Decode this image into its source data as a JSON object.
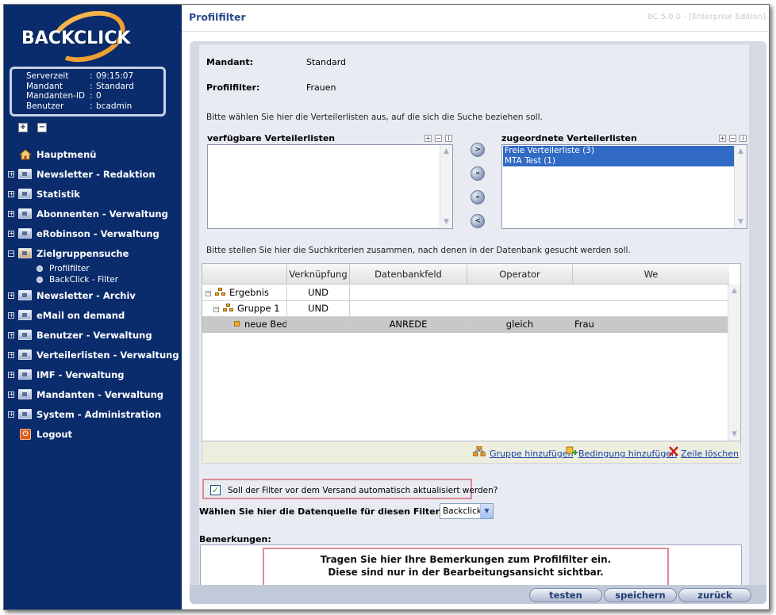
{
  "brand": {
    "logo_text": "BACKCLICK"
  },
  "server_info": {
    "rows": [
      {
        "key": "Serverzeit",
        "value": "09:15:07"
      },
      {
        "key": "Mandant",
        "value": "Standard"
      },
      {
        "key": "Mandanten-ID",
        "value": "0"
      },
      {
        "key": "Benutzer",
        "value": "bcadmin"
      }
    ]
  },
  "sidebar": {
    "items": [
      {
        "label": "Hauptmenü"
      },
      {
        "label": "Newsletter - Redaktion"
      },
      {
        "label": "Statistik"
      },
      {
        "label": "Abonnenten - Verwaltung"
      },
      {
        "label": "eRobinson - Verwaltung"
      },
      {
        "label": "Zielgruppensuche"
      },
      {
        "label": "Newsletter - Archiv"
      },
      {
        "label": "eMail on demand"
      },
      {
        "label": "Benutzer - Verwaltung"
      },
      {
        "label": "Verteilerlisten - Verwaltung"
      },
      {
        "label": "IMF - Verwaltung"
      },
      {
        "label": "Mandanten - Verwaltung"
      },
      {
        "label": "System - Administration"
      },
      {
        "label": "Logout"
      }
    ],
    "sub_items": [
      {
        "label": "Profilfilter"
      },
      {
        "label": "BackClick - Filter"
      }
    ]
  },
  "header": {
    "title": "Profilfilter",
    "version": "BC 5.0.0 - [Enterprise Edition]"
  },
  "form": {
    "mandant_label": "Mandant:",
    "mandant_value": "Standard",
    "filter_label": "Profilfilter:",
    "filter_value": "Frauen",
    "lists_hint": "Bitte wählen Sie hier die Verteilerlisten aus, auf die sich die Suche beziehen soll.",
    "available_title": "verfügbare Verteilerlisten",
    "assigned_title": "zugeordnete Verteilerlisten",
    "assigned_items": [
      "Freie Verteilerliste (3)",
      "MTA Test (1)"
    ],
    "criteria_hint": "Bitte stellen Sie hier die Suchkriterien zusammen, nach denen in der Datenbank gesucht werden soll.",
    "auto_update_label": "Soll der Filter vor dem Versand automatisch aktualisiert werden?",
    "auto_update_checked": true,
    "source_label": "Wählen Sie hier die Datenquelle für diesen Filter aus:",
    "source_value": "Backclick",
    "remarks_label": "Bemerkungen:",
    "remarks_note_line1": "Tragen Sie hier Ihre Bemerkungen zum Profilfilter ein.",
    "remarks_note_line2": "Diese sind nur in der Bearbeitungsansicht sichtbar."
  },
  "grid": {
    "columns": [
      "",
      "Verknüpfung",
      "Datenbankfeld",
      "Operator",
      "We"
    ],
    "rows": [
      {
        "name": "Ergebnis",
        "link": "UND",
        "field": "",
        "operator": "",
        "value": ""
      },
      {
        "name": "Gruppe 1",
        "link": "UND",
        "field": "",
        "operator": "",
        "value": ""
      },
      {
        "name": "neue Bedingung",
        "link": "",
        "field": "ANREDE",
        "operator": "gleich",
        "value": "Frau"
      }
    ],
    "actions": {
      "add_group": "Gruppe hinzufügen",
      "add_condition": "Bedingung hinzufügen",
      "delete_row": "Zeile löschen"
    }
  },
  "buttons": {
    "test": "testen",
    "save": "speichern",
    "back": "zurück"
  },
  "colors": {
    "sidebar_bg": "#0a2c6c",
    "accent": "#f0a030",
    "title": "#2a4b8c",
    "selection": "#316ac5",
    "highlight_border": "#e08a92"
  }
}
